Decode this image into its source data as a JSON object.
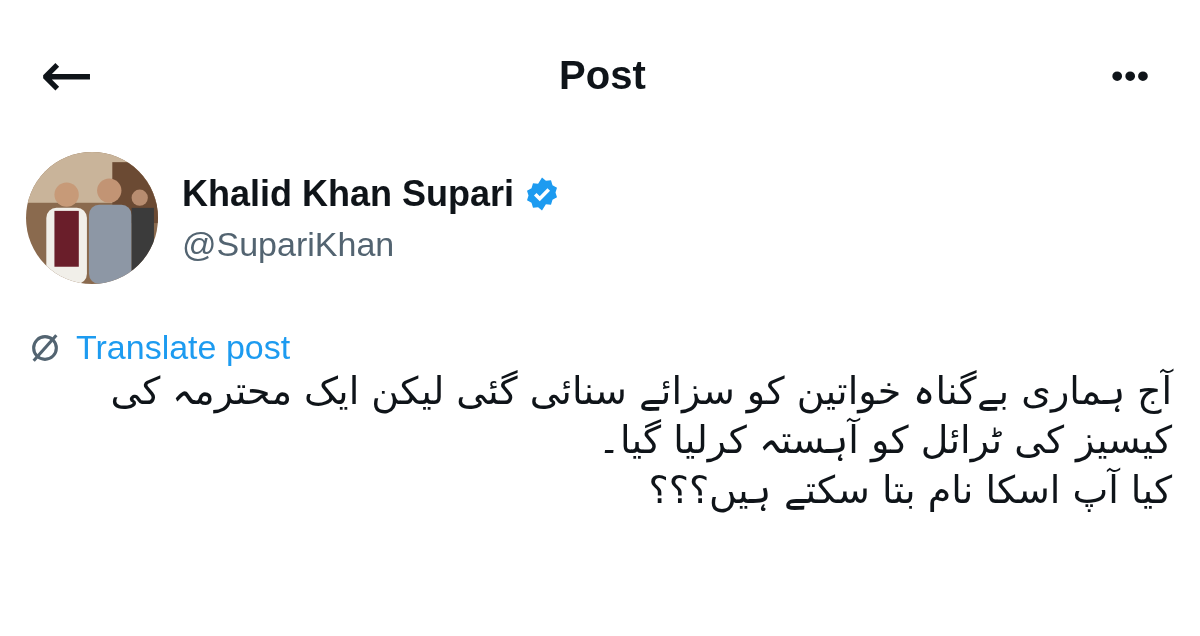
{
  "header": {
    "back": "←",
    "title": "Post",
    "more": "•••"
  },
  "author": {
    "name": "Khalid Khan Supari",
    "verified": true,
    "handle": "@SupariKhan"
  },
  "translate": {
    "label": "Translate post"
  },
  "post": {
    "lines": [
      "آج ہماری بےگناہ خواتین کو سزائے سنائی گئی لیکن ایک محترمہ کی کیسیز کی ٹرائل کو آہستہ کرلیا گیا۔",
      "کیا آپ اسکا نام بتا سکتے ہیں؟؟؟"
    ]
  }
}
